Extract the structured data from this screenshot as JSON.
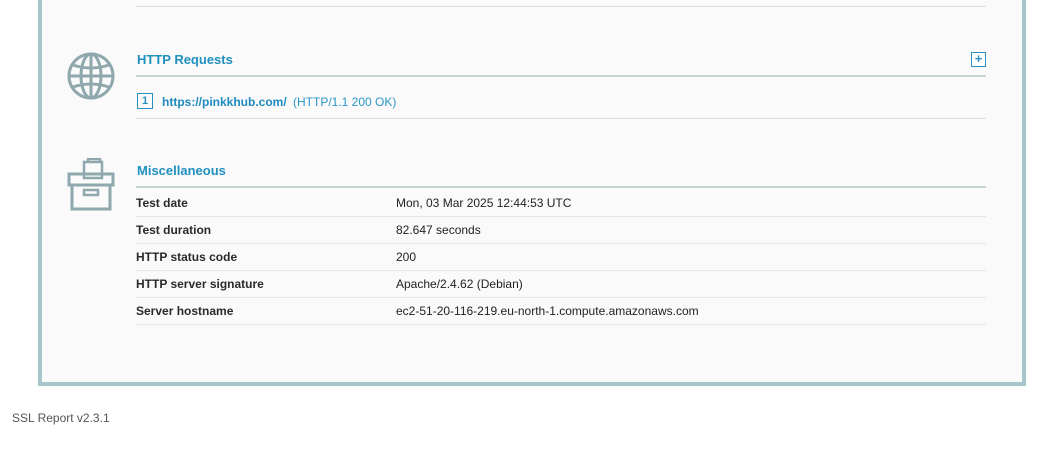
{
  "http_requests": {
    "title": "HTTP Requests",
    "expand_symbol": "+",
    "items": [
      {
        "index": "1",
        "url": "https://pinkkhub.com/",
        "status": "(HTTP/1.1 200 OK)"
      }
    ]
  },
  "miscellaneous": {
    "title": "Miscellaneous",
    "rows": [
      {
        "label": "Test date",
        "value": "Mon, 03 Mar 2025 12:44:53 UTC"
      },
      {
        "label": "Test duration",
        "value": "82.647 seconds"
      },
      {
        "label": "HTTP status code",
        "value": "200"
      },
      {
        "label": "HTTP server signature",
        "value": "Apache/2.4.62 (Debian)"
      },
      {
        "label": "Server hostname",
        "value": "ec2-51-20-116-219.eu-north-1.compute.amazonaws.com"
      }
    ]
  },
  "footer": {
    "version": "SSL Report v2.3.1"
  },
  "colors": {
    "frame_border": "#a6c6cb",
    "section_title": "#2090c0",
    "icon_stroke": "#8fa8ad"
  },
  "icons": {
    "http_requests": "globe-icon",
    "miscellaneous": "archive-box-icon",
    "expand": "plus-square-icon"
  }
}
